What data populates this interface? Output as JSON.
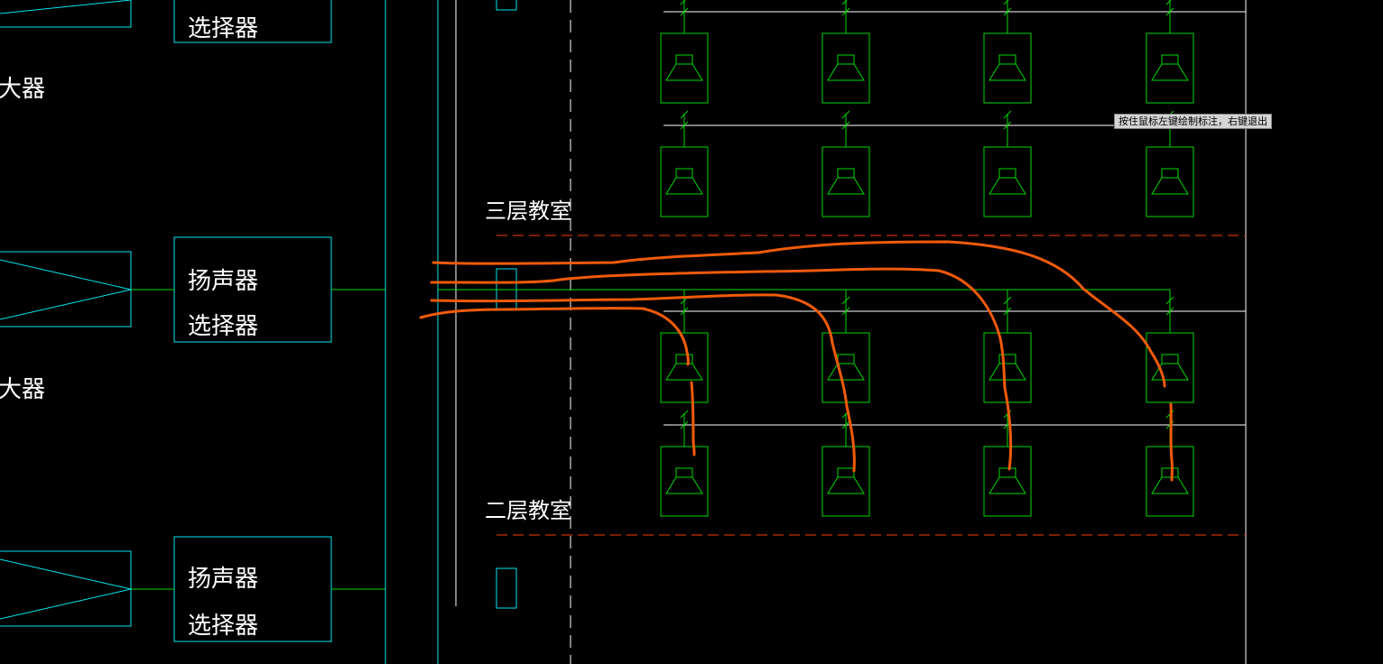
{
  "diagram": {
    "labels": {
      "amplifier_suffix": "大器",
      "speaker": "扬声器",
      "selector": "选择器",
      "floor3": "三层教室",
      "floor2": "二层教室"
    },
    "colors": {
      "background": "#000000",
      "cyan": "#00e5ee",
      "green": "#00d800",
      "white": "#ffffff",
      "red_dashed": "#c83200",
      "orange_markup": "#f05a0a"
    },
    "speaker_grid": {
      "columns": 4,
      "rows_per_floor": 2,
      "floors_visible": [
        "upper (partial)",
        "三层教室"
      ]
    }
  },
  "tooltip": {
    "text": "按住鼠标左键绘制标注，右键退出"
  }
}
